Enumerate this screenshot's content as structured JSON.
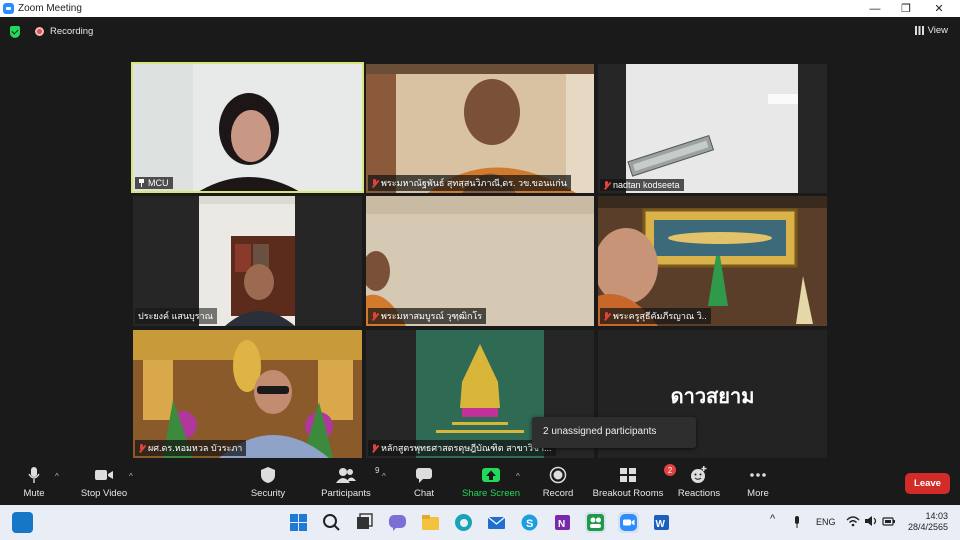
{
  "window": {
    "title": "Zoom Meeting"
  },
  "topbar": {
    "recording_label": "Recording",
    "view_label": "View"
  },
  "participants": [
    {
      "name": "MCU",
      "icon": "pin-icon"
    },
    {
      "name": "พระมหาณัฐพันธ์ สุทสฺสนวิภาณี,ดร. วข.ขอนแก่น",
      "icon": "mic-muted-icon"
    },
    {
      "name": "nadtan kodseeta",
      "icon": "mic-muted-icon"
    },
    {
      "name": "ประยงค์ แสนบุราณ",
      "icon": ""
    },
    {
      "name": "พระมหาสมบูรณ์ วุฑฺฒิกโร",
      "icon": "mic-muted-icon"
    },
    {
      "name": "พระครูสุธีคัมภีรญาณ วิ..",
      "icon": "mic-muted-icon"
    },
    {
      "name": "ผศ.ดร.หอมหวล บัวระภา",
      "icon": "mic-muted-icon"
    },
    {
      "name": "หลักสูตรพุทธศาสตรดุษฎีบัณฑิต สาขาวิชา...",
      "icon": "mic-muted-icon"
    },
    {
      "name": "",
      "icon": "",
      "overlay_text": "ดาวสยาม"
    }
  ],
  "toast": {
    "text": "2 unassigned participants"
  },
  "toolbar": {
    "mute": "Mute",
    "stop_video": "Stop Video",
    "security": "Security",
    "participants": "Participants",
    "participants_count": "9",
    "chat": "Chat",
    "share_screen": "Share Screen",
    "record": "Record",
    "breakout_rooms": "Breakout Rooms",
    "breakout_badge": "2",
    "reactions": "Reactions",
    "more": "More",
    "leave": "Leave"
  },
  "taskbar": {
    "language": "ENG",
    "time": "14:03",
    "date": "28/4/2565"
  },
  "colors": {
    "active_speaker_border": "#d6e67a",
    "share_screen_green": "#23d959",
    "leave_red": "#d32c28",
    "badge_red": "#e0433e"
  }
}
